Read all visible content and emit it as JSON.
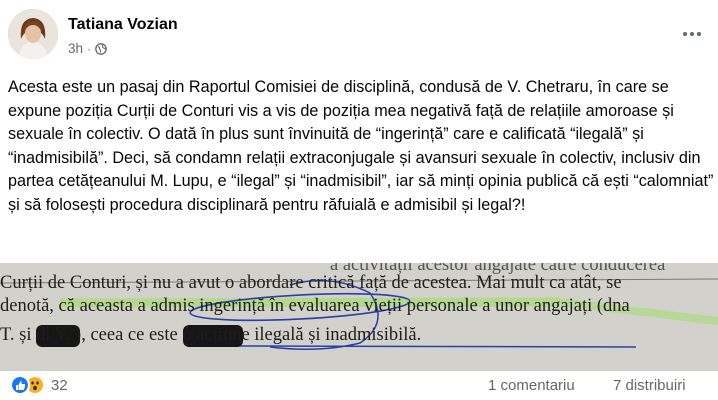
{
  "post": {
    "author": "Tatiana Vozian",
    "time": "3h",
    "separator": "·",
    "privacy_icon": "globe-icon",
    "more_icon": "more-options-icon",
    "text": "Acesta este un pasaj din Raportul Comisiei de disciplină, condusă de V. Chetraru, în care se expune poziția Curții de Conturi vis a vis de poziția mea negativă față de relațiile amoroase și sexuale în colectiv. O dată în plus sunt învinuită de “ingerință” care e calificată “ilegală” și “inadmisibilă”. Deci, să condamn relații extraconjugale și avansuri sexuale în colectiv, inclusiv din partea cetățeanului M. Lupu, e “ilegal” și “inadmisibil”, iar să minți opinia publică că ești “calomniat” și să folosești procedura disciplinară pentru răfuială e admisibil și legal?!"
  },
  "photo": {
    "lines": [
      "Curții de Conturi, și nu a avut o abordare critică față de acestea. Mai mult ca atât, se",
      "denotă, că aceasta a admis ingerință în evaluarea vieții personale a unor angajați (dna",
      "T.            și dl V.            ), ceea ce este o acțiune ilegală și inadmisibilă."
    ],
    "top_partial": "a activității acestor angajate către conducerea"
  },
  "footer": {
    "reaction_icons": [
      "like-icon",
      "wow-icon"
    ],
    "reaction_count": "32",
    "comments": "1 comentariu",
    "shares": "7 distribuiri"
  },
  "colors": {
    "like": "#1877f2",
    "wow": "#f7b125",
    "secondary_text": "#65676b",
    "highlight": "#7bd23f",
    "pen": "#2b3fa8"
  }
}
